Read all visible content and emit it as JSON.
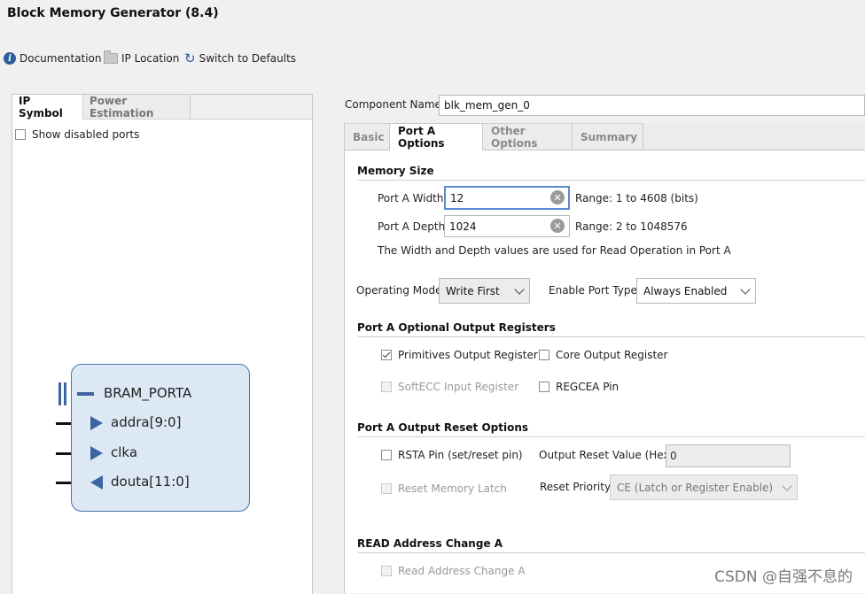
{
  "window": {
    "title": "Block Memory Generator (8.4)"
  },
  "toolbar": {
    "documentation": "Documentation",
    "ip_location": "IP Location",
    "switch_defaults": "Switch to Defaults"
  },
  "left_tabs": {
    "ip_symbol": "IP Symbol",
    "power_estimation": "Power Estimation"
  },
  "show_disabled_ports": {
    "label": "Show disabled ports",
    "checked": false
  },
  "symbol": {
    "bus": "BRAM_PORTA",
    "ports": [
      {
        "name": "addra[9:0]",
        "direction": "in"
      },
      {
        "name": "clka",
        "direction": "in"
      },
      {
        "name": "douta[11:0]",
        "direction": "out"
      }
    ]
  },
  "component": {
    "label": "Component Name",
    "value": "blk_mem_gen_0"
  },
  "tabs": [
    {
      "label": "Basic",
      "active": false
    },
    {
      "label": "Port A Options",
      "active": true
    },
    {
      "label": "Other Options",
      "active": false
    },
    {
      "label": "Summary",
      "active": false
    }
  ],
  "memory_size": {
    "heading": "Memory Size",
    "width_label": "Port A Width",
    "width_value": "12",
    "width_range": "Range: 1 to 4608 (bits)",
    "depth_label": "Port A Depth",
    "depth_value": "1024",
    "depth_range": "Range: 2 to 1048576",
    "note": "The Width and Depth values are used for Read Operation in Port A"
  },
  "operating_mode": {
    "label": "Operating Mode",
    "value": "Write First"
  },
  "enable_port_type": {
    "label": "Enable Port Type",
    "value": "Always Enabled"
  },
  "optional_output_registers": {
    "heading": "Port A Optional Output Registers",
    "primitives": {
      "label": "Primitives Output Register",
      "checked": true
    },
    "core": {
      "label": "Core Output Register",
      "checked": false
    },
    "softecc": {
      "label": "SoftECC Input Register",
      "checked": false,
      "disabled": true
    },
    "regcea": {
      "label": "REGCEA Pin",
      "checked": false
    }
  },
  "reset_options": {
    "heading": "Port A Output Reset Options",
    "rsta": {
      "label": "RSTA Pin (set/reset pin)",
      "checked": false
    },
    "reset_value_label": "Output Reset Value (Hex)",
    "reset_value": "0",
    "reset_memory_latch": {
      "label": "Reset Memory Latch",
      "checked": false,
      "disabled": true
    },
    "reset_priority_label": "Reset Priority",
    "reset_priority_value": "CE (Latch or Register Enable)"
  },
  "read_address_change": {
    "heading": "READ Address Change A",
    "checkbox": {
      "label": "Read Address Change A",
      "checked": false,
      "disabled": true
    }
  },
  "watermark": "CSDN @自强不息的"
}
